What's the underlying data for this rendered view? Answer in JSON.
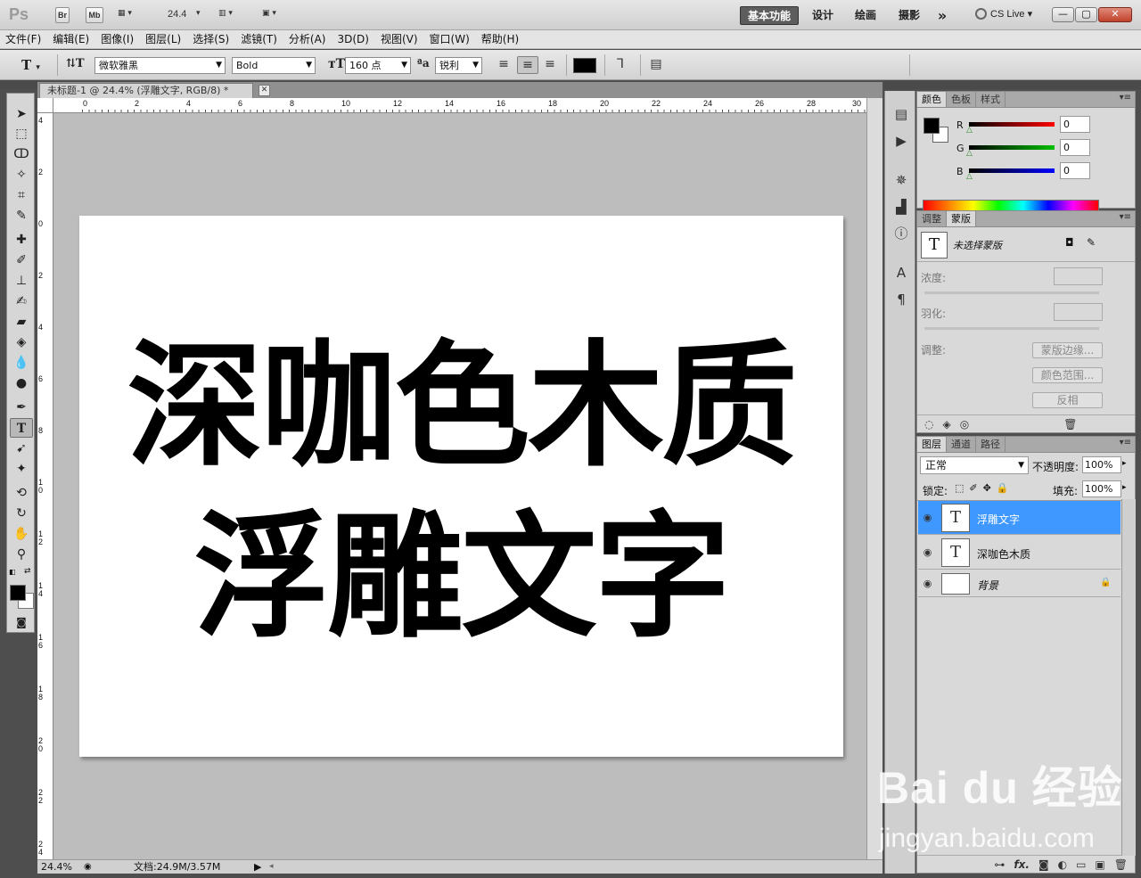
{
  "app": {
    "logo": "Ps",
    "br_button": "Br",
    "mb_button": "Mb",
    "zoom_select": "24.4",
    "workspaces": [
      "基本功能",
      "设计",
      "绘画",
      "摄影"
    ],
    "more_workspaces": "»",
    "cs_live": "CS Live",
    "window_buttons": [
      "—",
      "▢",
      "✕"
    ]
  },
  "menu": [
    "文件(F)",
    "编辑(E)",
    "图像(I)",
    "图层(L)",
    "选择(S)",
    "滤镜(T)",
    "分析(A)",
    "3D(D)",
    "视图(V)",
    "窗口(W)",
    "帮助(H)"
  ],
  "options": {
    "font_family": "微软雅黑",
    "font_style": "Bold",
    "font_size": "160 点",
    "aa_label": "ªa",
    "antialias": "锐利",
    "text_color": "#000000"
  },
  "document": {
    "tab_title": "未标题-1 @ 24.4% (浮雕文字, RGB/8) *",
    "tab_close": "✕",
    "ruler_h": [
      "0",
      "2",
      "4",
      "6",
      "8",
      "10",
      "12",
      "14",
      "16",
      "18",
      "20",
      "22",
      "24",
      "26",
      "28",
      "30"
    ],
    "ruler_v": [
      "4",
      "2",
      "0",
      "2",
      "4",
      "6",
      "8",
      "10",
      "12",
      "14",
      "16",
      "18",
      "20",
      "22",
      "24"
    ],
    "canvas_line1": "深咖色木质",
    "canvas_line2": "浮雕文字",
    "zoom_status": "24.4%",
    "doc_size": "文档:24.9M/3.57M"
  },
  "color_panel": {
    "tabs": [
      "颜色",
      "色板",
      "样式"
    ],
    "channels": [
      {
        "label": "R",
        "value": "0",
        "color": "#ff0000"
      },
      {
        "label": "G",
        "value": "0",
        "color": "#00c000"
      },
      {
        "label": "B",
        "value": "0",
        "color": "#0000ff"
      }
    ]
  },
  "mask_panel": {
    "tabs": [
      "调整",
      "蒙版"
    ],
    "no_mask": "未选择蒙版",
    "density_label": "浓度:",
    "feather_label": "羽化:",
    "adjust_label": "调整:",
    "btn_edge": "蒙版边缘...",
    "btn_range": "颜色范围...",
    "btn_invert": "反相"
  },
  "layers_panel": {
    "tabs": [
      "图层",
      "通道",
      "路径"
    ],
    "blend_mode": "正常",
    "opacity_label": "不透明度:",
    "opacity_value": "100%",
    "lock_label": "锁定:",
    "fill_label": "填充:",
    "fill_value": "100%",
    "layers": [
      {
        "name": "浮雕文字",
        "thumb": "T",
        "selected": true
      },
      {
        "name": "深咖色木质",
        "thumb": "T",
        "selected": false
      },
      {
        "name": "背景",
        "thumb": "",
        "selected": false,
        "locked": true
      }
    ],
    "bottom_icons": [
      "link-icon",
      "fx-icon",
      "mask-icon",
      "adjustment-icon",
      "folder-icon",
      "new-layer-icon",
      "trash-icon"
    ]
  },
  "watermark": {
    "logo": "Bai du 经验",
    "url": "jingyan.baidu.com"
  }
}
